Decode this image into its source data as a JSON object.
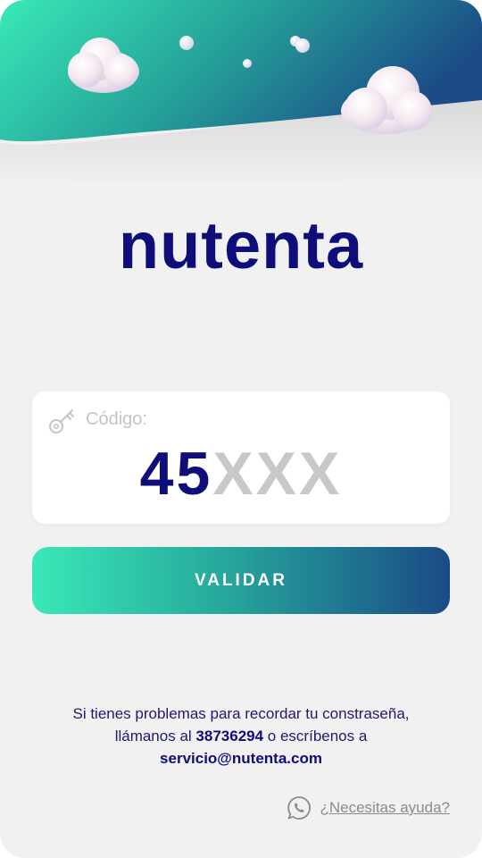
{
  "brand": {
    "name": "nutenta"
  },
  "code_field": {
    "label": "Código:",
    "entered": "45",
    "placeholder_rest": "XXX"
  },
  "validate_button": {
    "label": "VALIDAR"
  },
  "help": {
    "line1": "Si tienes problemas para recordar tu constraseña,",
    "line2_prefix": "llámanos al",
    "phone": "38736294",
    "line2_suffix": "o escríbenos a",
    "email": "servicio@nutenta.com"
  },
  "support_link": {
    "label": "¿Necesitas ayuda?",
    "icon": "whatsapp-icon"
  },
  "colors": {
    "brand_navy": "#0f0d7a",
    "gradient_start": "#3ae8b7",
    "gradient_end": "#1a4a86",
    "background": "#f1f1f2"
  }
}
